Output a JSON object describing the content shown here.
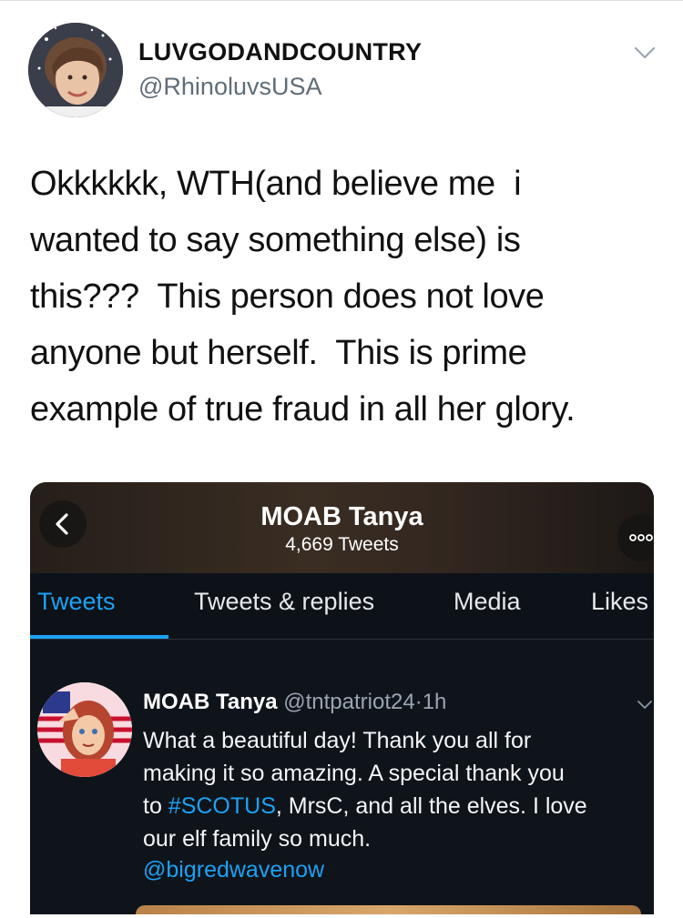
{
  "author": {
    "display_name": "LUVGODANDCOUNTRY",
    "handle": "@RhinoluvsUSA",
    "avatar_icon": "profile-photo",
    "menu_icon": "chevron-down-icon"
  },
  "tweet": {
    "lines": [
      "Okkkkkk, WTH(and believe me  i",
      "wanted to say something else) is",
      "this???  This person does not love",
      "anyone but herself.  This is prime",
      "example of true fraud in all her glory."
    ]
  },
  "embedded": {
    "profile_name": "MOAB Tanya",
    "tweet_count": "4,669 Tweets",
    "back_icon": "chevron-left-icon",
    "more_icon": "more-icon",
    "tabs": [
      "Tweets",
      "Tweets & replies",
      "Media",
      "Likes"
    ],
    "active_tab": "Tweets",
    "post": {
      "name": "MOAB Tanya",
      "handle": "@tntpatriot24",
      "dot": "·",
      "time": "1h",
      "line1": "What a beautiful day! Thank you all for",
      "line2": "making it so amazing. A special thank you",
      "line3_pre": "to ",
      "line3_hashtag": "#SCOTUS",
      "line3_post": ", MrsC, and all the elves. I love",
      "line4": "our elf family so much.",
      "mention": "@bigredwavenow"
    }
  },
  "colors": {
    "link_blue": "#1da1f2",
    "handle_gray": "#5f6d79",
    "embed_bg": "#0f141b"
  }
}
